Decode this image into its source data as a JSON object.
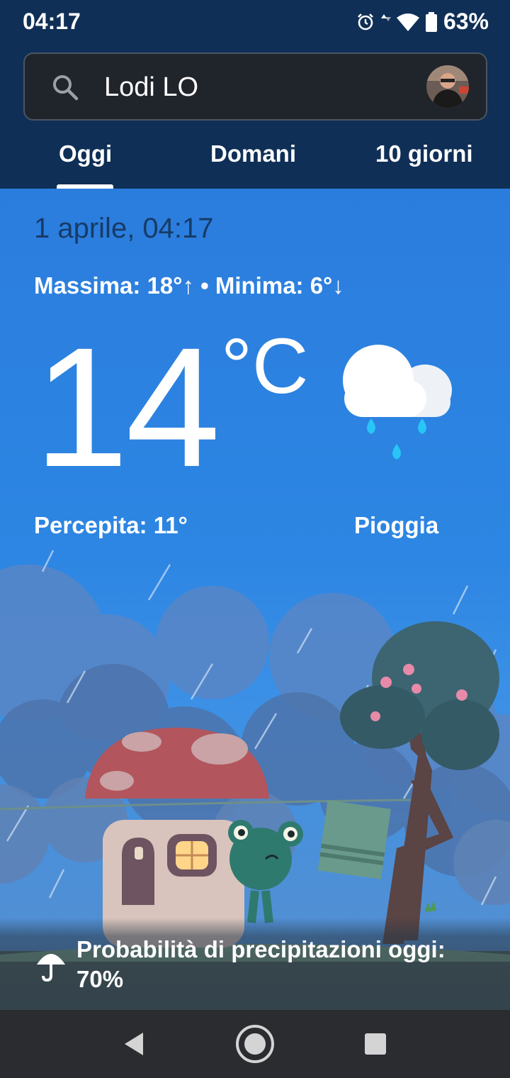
{
  "status_bar": {
    "time": "04:17",
    "battery": "63%",
    "icons": [
      "alarm-icon",
      "data-arrows-icon",
      "wifi-icon",
      "battery-icon"
    ]
  },
  "search": {
    "location": "Lodi LO",
    "icon": "search-icon"
  },
  "tabs": [
    {
      "label": "Oggi",
      "selected": true
    },
    {
      "label": "Domani",
      "selected": false
    },
    {
      "label": "10 giorni",
      "selected": false
    }
  ],
  "weather": {
    "date": "1 aprile, 04:17",
    "minmax": "Massima: 18°↑ • Minima: 6°↓",
    "temperature": "14",
    "unit": "°C",
    "feels_like": "Percepita: 11°",
    "condition": "Pioggia",
    "condition_icon": "rain-cloud-icon"
  },
  "precipitation": {
    "text": "Probabilità di precipitazioni oggi: 70%",
    "icon": "umbrella-icon"
  },
  "colors": {
    "header_bg": "#0f2f56",
    "sky": "#2d86e3",
    "search_bg": "#20242b",
    "nav_bg": "#2a2c30",
    "rain_drop": "#29c5f6"
  },
  "nav": {
    "icons": [
      "back-icon",
      "home-icon",
      "recents-icon"
    ]
  }
}
